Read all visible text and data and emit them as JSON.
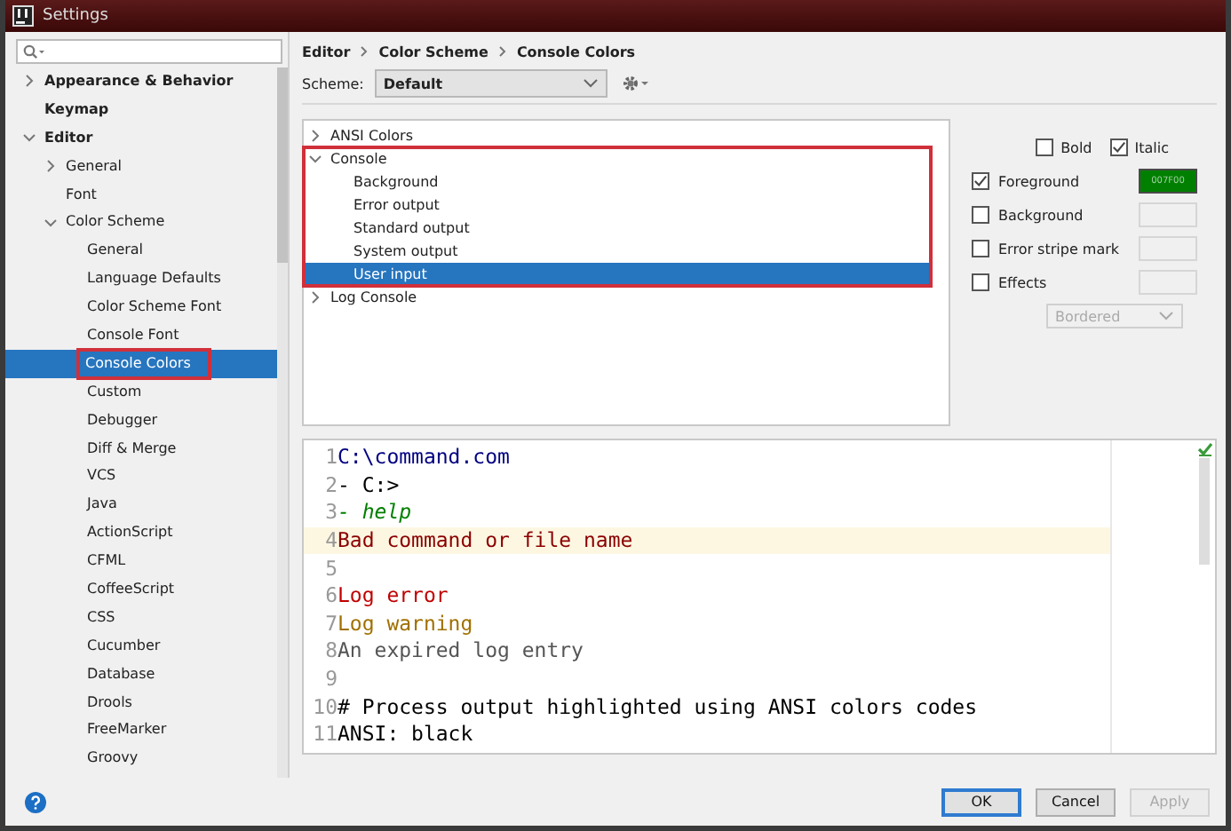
{
  "window": {
    "title": "Settings"
  },
  "sidebar": {
    "tree": [
      {
        "label": "Appearance & Behavior",
        "bold": true,
        "expanded": false,
        "selected": false
      },
      {
        "label": "Keymap",
        "bold": true,
        "selected": false
      },
      {
        "label": "Editor",
        "bold": true,
        "expanded": true,
        "selected": false,
        "children": [
          {
            "label": "General",
            "bold": false,
            "expanded": false,
            "selected": false
          },
          {
            "label": "Font",
            "bold": false,
            "selected": false
          },
          {
            "label": "Color Scheme",
            "bold": false,
            "expanded": true,
            "selected": false,
            "children": [
              {
                "label": "General",
                "bold": false,
                "selected": false
              },
              {
                "label": "Language Defaults",
                "bold": false,
                "selected": false
              },
              {
                "label": "Color Scheme Font",
                "bold": false,
                "selected": false
              },
              {
                "label": "Console Font",
                "bold": false,
                "selected": false
              },
              {
                "label": "Console Colors",
                "bold": false,
                "selected": true,
                "annotated": true
              },
              {
                "label": "Custom",
                "bold": false,
                "selected": false
              },
              {
                "label": "Debugger",
                "bold": false,
                "selected": false
              },
              {
                "label": "Diff & Merge",
                "bold": false,
                "selected": false
              },
              {
                "label": "VCS",
                "bold": false,
                "selected": false
              },
              {
                "label": "Java",
                "bold": false,
                "selected": false
              },
              {
                "label": "ActionScript",
                "bold": false,
                "selected": false
              },
              {
                "label": "CFML",
                "bold": false,
                "selected": false
              },
              {
                "label": "CoffeeScript",
                "bold": false,
                "selected": false
              },
              {
                "label": "CSS",
                "bold": false,
                "selected": false
              },
              {
                "label": "Cucumber",
                "bold": false,
                "selected": false
              },
              {
                "label": "Database",
                "bold": false,
                "selected": false
              },
              {
                "label": "Drools",
                "bold": false,
                "selected": false
              },
              {
                "label": "FreeMarker",
                "bold": false,
                "selected": false
              },
              {
                "label": "Groovy",
                "bold": false,
                "selected": false
              }
            ]
          }
        ]
      }
    ]
  },
  "breadcrumbs": [
    "Editor",
    "Color Scheme",
    "Console Colors"
  ],
  "scheme": {
    "label": "Scheme:",
    "value": "Default"
  },
  "attributes_tree": [
    {
      "label": "ANSI Colors",
      "expanded": false,
      "selected": false
    },
    {
      "label": "Console",
      "expanded": true,
      "selected": false,
      "annotated": true,
      "children": [
        {
          "label": "Background",
          "selected": false
        },
        {
          "label": "Error output",
          "selected": false
        },
        {
          "label": "Standard output",
          "selected": false
        },
        {
          "label": "System output",
          "selected": false
        },
        {
          "label": "User input",
          "selected": true
        }
      ]
    },
    {
      "label": "Log Console",
      "expanded": false,
      "selected": false
    }
  ],
  "font_styles": [
    {
      "label": "Bold",
      "checked": false
    },
    {
      "label": "Italic",
      "checked": true
    }
  ],
  "color_options": [
    {
      "label": "Foreground",
      "checked": true,
      "value": "007F00",
      "color": "#007f00"
    },
    {
      "label": "Background",
      "checked": false
    },
    {
      "label": "Error stripe mark",
      "checked": false
    },
    {
      "label": "Effects",
      "checked": false
    }
  ],
  "effects_type": {
    "value": "Bordered",
    "disabled": true
  },
  "preview": {
    "lines": [
      {
        "number": "1",
        "text": "C:\\command.com",
        "color": "#000080",
        "italic": false,
        "current": false
      },
      {
        "number": "2",
        "text": "- C:>",
        "color": "#000000",
        "italic": false,
        "current": false
      },
      {
        "number": "3",
        "text": "- help",
        "color": "#007f00",
        "italic": true,
        "current": false
      },
      {
        "number": "4",
        "text": "Bad command or file name",
        "color": "#8b0000",
        "italic": false,
        "current": true
      },
      {
        "number": "5",
        "current": false
      },
      {
        "number": "6",
        "text": "Log error",
        "color": "#c00000",
        "italic": false,
        "current": false
      },
      {
        "number": "7",
        "text": "Log warning",
        "color": "#a07000",
        "italic": false,
        "current": false
      },
      {
        "number": "8",
        "text": "An expired log entry",
        "color": "#555555",
        "italic": false,
        "current": false
      },
      {
        "number": "9",
        "current": false
      },
      {
        "number": "10",
        "text": "# Process output highlighted using ANSI colors codes",
        "color": "#000000",
        "italic": false,
        "current": false
      },
      {
        "number": "11",
        "text": "ANSI: black",
        "color": "#000000",
        "italic": false,
        "current": false
      }
    ]
  },
  "buttons": [
    {
      "label": "OK",
      "kind": "default",
      "disabled": false
    },
    {
      "label": "Cancel",
      "kind": "normal",
      "disabled": false
    },
    {
      "label": "Apply",
      "kind": "normal",
      "disabled": true
    }
  ]
}
